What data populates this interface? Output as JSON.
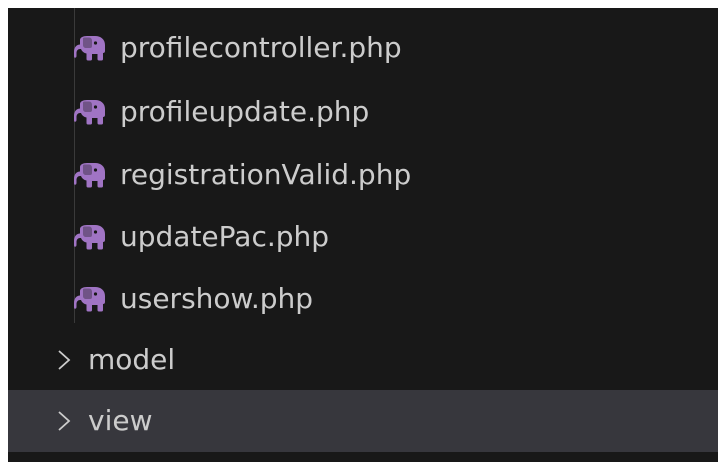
{
  "explorer": {
    "files": [
      {
        "name": "profilecontroller.php",
        "icon": "php-elephant-icon"
      },
      {
        "name": "profileupdate.php",
        "icon": "php-elephant-icon"
      },
      {
        "name": "registrationValid.php",
        "icon": "php-elephant-icon"
      },
      {
        "name": "updatePac.php",
        "icon": "php-elephant-icon"
      },
      {
        "name": "usershow.php",
        "icon": "php-elephant-icon"
      }
    ],
    "folders": [
      {
        "name": "model",
        "collapsed": true,
        "selected": false,
        "icon": "chevron-right-icon"
      },
      {
        "name": "view",
        "collapsed": true,
        "selected": true,
        "icon": "chevron-right-icon"
      }
    ]
  },
  "colors": {
    "background": "#181818",
    "selected_row": "#37373d",
    "text": "#cccccc",
    "php_icon": "#a074c4"
  }
}
